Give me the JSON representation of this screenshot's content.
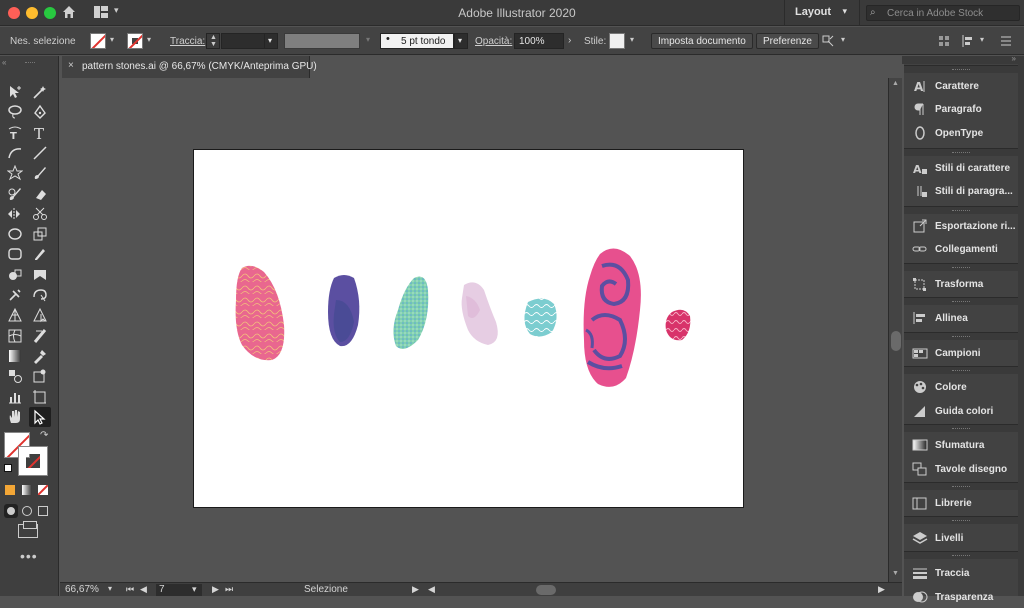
{
  "window": {
    "app_title": "Adobe Illustrator 2020",
    "workspace_label": "Layout",
    "stock_search_placeholder": "Cerca in Adobe Stock"
  },
  "control_bar": {
    "selection_label": "Nes. selezione",
    "stroke_label": "Traccia:",
    "brush_value": "5 pt tondo",
    "opacity_label": "Opacità:",
    "opacity_value": "100%",
    "style_label": "Stile:",
    "document_setup_button": "Imposta documento",
    "preferences_button": "Preferenze"
  },
  "document_tab": {
    "title": "pattern stones.ai @ 66,67% (CMYK/Anteprima GPU)"
  },
  "status_bar": {
    "zoom": "66,67%",
    "artboard_number": "7",
    "mode": "Selezione"
  },
  "panels": [
    {
      "label": "Carattere",
      "icon": "character-icon"
    },
    {
      "label": "Paragrafo",
      "icon": "paragraph-icon"
    },
    {
      "label": "OpenType",
      "icon": "opentype-icon"
    },
    {
      "label": "Stili di carattere",
      "icon": "character-styles-icon"
    },
    {
      "label": "Stili di paragra...",
      "icon": "paragraph-styles-icon"
    },
    {
      "label": "Esportazione ri...",
      "icon": "asset-export-icon"
    },
    {
      "label": "Collegamenti",
      "icon": "links-icon"
    },
    {
      "label": "Trasforma",
      "icon": "transform-icon"
    },
    {
      "label": "Allinea",
      "icon": "align-icon"
    },
    {
      "label": "Campioni",
      "icon": "swatches-icon"
    },
    {
      "label": "Colore",
      "icon": "color-icon"
    },
    {
      "label": "Guida colori",
      "icon": "color-guide-icon"
    },
    {
      "label": "Sfumatura",
      "icon": "gradient-icon"
    },
    {
      "label": "Tavole disegno",
      "icon": "artboards-icon"
    },
    {
      "label": "Librerie",
      "icon": "libraries-icon"
    },
    {
      "label": "Livelli",
      "icon": "layers-icon"
    },
    {
      "label": "Traccia",
      "icon": "stroke-icon"
    },
    {
      "label": "Trasparenza",
      "icon": "transparency-icon"
    }
  ],
  "stones": [
    {
      "name": "stone-pink-lines",
      "color": "#e65c8a"
    },
    {
      "name": "stone-purple",
      "color": "#5b4fa1"
    },
    {
      "name": "stone-green-dots",
      "color": "#6cc3a2"
    },
    {
      "name": "stone-lilac",
      "color": "#e6cde3"
    },
    {
      "name": "stone-teal",
      "color": "#7ccdd0"
    },
    {
      "name": "stone-large-spiral",
      "color": "#e7508e"
    },
    {
      "name": "stone-small-red",
      "color": "#d8336a"
    }
  ]
}
